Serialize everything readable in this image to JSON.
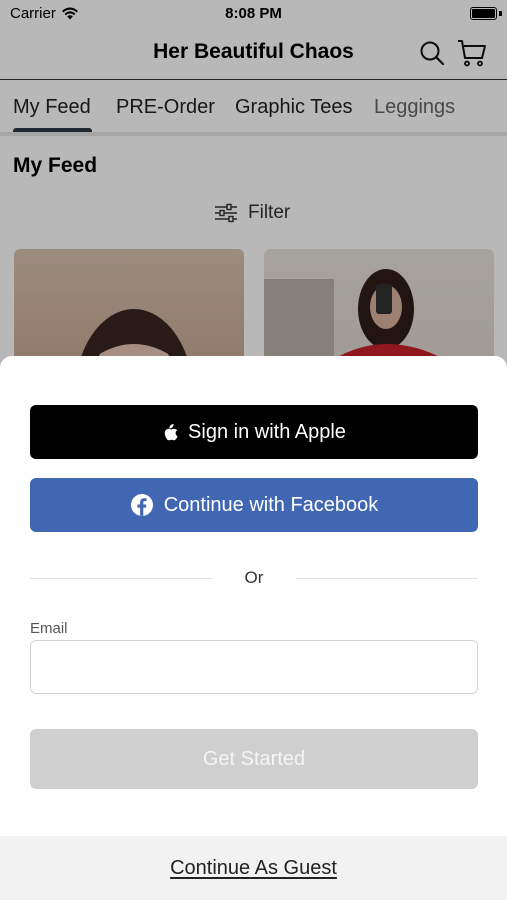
{
  "status_bar": {
    "carrier": "Carrier",
    "time": "8:08 PM"
  },
  "header": {
    "title": "Her Beautiful Chaos"
  },
  "tabs": [
    {
      "label": "My Feed",
      "active": true
    },
    {
      "label": "PRE-Order"
    },
    {
      "label": "Graphic Tees"
    },
    {
      "label": "Leggings"
    }
  ],
  "feed": {
    "section_title": "My Feed",
    "filter_label": "Filter"
  },
  "sheet": {
    "apple_label": "Sign in with Apple",
    "facebook_label": "Continue with Facebook",
    "or_label": "Or",
    "email_label": "Email",
    "email_value": "",
    "email_placeholder": "",
    "get_started_label": "Get Started",
    "guest_label": "Continue As Guest"
  },
  "colors": {
    "facebook_blue": "#4267b2",
    "apple_black": "#000000",
    "disabled_button": "#cfcfcf",
    "tab_indicator": "#2f3b46"
  }
}
